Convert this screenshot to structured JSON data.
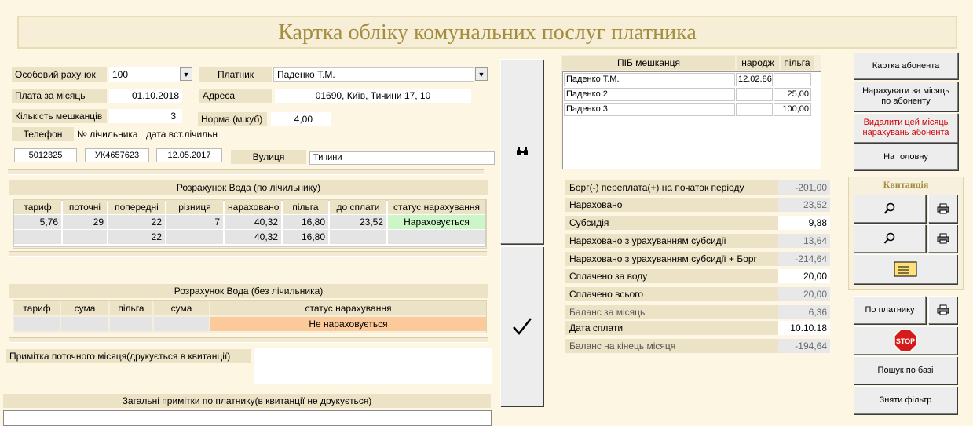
{
  "title": "Картка обліку комунальних послуг платника",
  "account": {
    "label": "Особовий рахунок",
    "value": "100"
  },
  "payer": {
    "label": "Платник",
    "value": "Паденко Т.М."
  },
  "monthly": {
    "label": "Плата за місяць",
    "value": "01.10.2018"
  },
  "address": {
    "label": "Адреса",
    "value": "01690, Київ, Тичини 17,  10"
  },
  "residents_count": {
    "label": "Кількість мешканців",
    "value": "3"
  },
  "norm": {
    "label": "Норма (м.куб)",
    "value": "4,00"
  },
  "phone": {
    "label": "Телефон",
    "value": "5012325"
  },
  "meter_no": {
    "label": "№ лічильника",
    "value": "УК4657623"
  },
  "meter_date": {
    "label": "дата вст.лічильн",
    "value": "12.05.2017"
  },
  "street": {
    "label": "Вулиця",
    "value": "Тичини"
  },
  "water_meter": {
    "title": "Розрахунок Вода (по лічильнику)",
    "headers": [
      "тариф",
      "поточні",
      "попередні",
      "різниця",
      "нараховано",
      "пільга",
      "до сплати",
      "статус нарахування"
    ],
    "row1": [
      "5,76",
      "29",
      "22",
      "7",
      "40,32",
      "16,80",
      "23,52",
      "Нараховується"
    ],
    "row2": [
      "",
      "",
      "22",
      "",
      "40,32",
      "16,80",
      "",
      ""
    ]
  },
  "water_nometer": {
    "title": "Розрахунок Вода (без лічильника)",
    "headers": [
      "тариф",
      "сума",
      "пільга",
      "сума",
      "статус нарахування"
    ],
    "status": "Не нараховується"
  },
  "note_month": "Примітка поточного місяця(друкується в квитанції)",
  "note_general": "Загальні примітки по платнику(в квитанції не друкується)",
  "residents": {
    "headers": [
      "ПІБ мешканця",
      "народж",
      "пільга"
    ],
    "rows": [
      [
        "Паденко Т.М.",
        "12.02.86",
        ""
      ],
      [
        "Паденко 2",
        "",
        "25,00"
      ],
      [
        "Паденко 3",
        "",
        "100,00"
      ]
    ]
  },
  "summary": [
    {
      "label": "Борг(-) переплата(+) на початок періоду",
      "value": "-201,00"
    },
    {
      "label": "Нараховано",
      "value": "23,52"
    },
    {
      "label": "Субсидія",
      "value": "9,88"
    },
    {
      "label": "Нараховано з урахуванням субсидії",
      "value": "13,64"
    },
    {
      "label": "Нараховано з урахуванням субсидії + Борг",
      "value": "-214,64"
    },
    {
      "label": "Сплачено за воду",
      "value": "20,00"
    },
    {
      "label": "Сплачено всього",
      "value": "20,00"
    },
    {
      "label": "Баланс за місяць",
      "value": "6,36"
    },
    {
      "label": "Дата сплати",
      "value": "10.10.18"
    },
    {
      "label": "Баланс на кінець місяця",
      "value": "-194,64"
    }
  ],
  "buttons": {
    "card": "Картка абонента",
    "accrue": "Нарахувати за місяць по абоненту",
    "delete": "Видалити цей місяць нарахувань абонента",
    "home": "На головну",
    "receipt": "Квитанція",
    "by_payer": "По платнику",
    "search": "Пошук по базі",
    "clear": "Зняти фільтр"
  },
  "colors": {
    "title": "#a38d3f",
    "ok_status": "#ccf5c8",
    "no_status": "#fbc99a",
    "delete_text": "#d00000",
    "stop": "#d51a1a"
  }
}
